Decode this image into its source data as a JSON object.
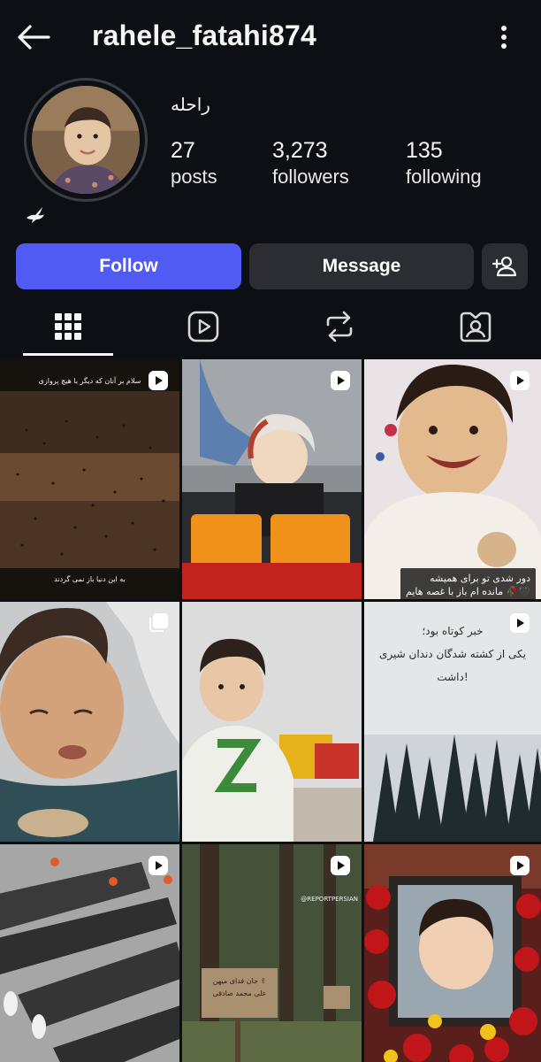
{
  "header": {
    "username": "rahele_fatahi874"
  },
  "profile": {
    "full_name": "راحله",
    "stats": [
      {
        "value": "27",
        "label": "posts"
      },
      {
        "value": "3,273",
        "label": "followers"
      },
      {
        "value": "135",
        "label": "following"
      }
    ]
  },
  "actions": {
    "follow": "Follow",
    "message": "Message"
  },
  "tabs": [
    "grid-icon",
    "reels-icon",
    "reposts-icon",
    "tagged-icon"
  ],
  "posts": [
    {
      "type": "reel",
      "caption_top": "سلام بر آنان که دیگر با هیچ پروازی",
      "caption_bottom": "به این دنیا باز نمی گردند"
    },
    {
      "type": "reel"
    },
    {
      "type": "reel",
      "caption": "دور شدی تو برای همیشه\nمانده ام باز با غصه هایم 🥀🖤"
    },
    {
      "type": "carousel"
    },
    {
      "type": "none"
    },
    {
      "type": "reel",
      "caption": "خبر کوتاه بود؛\nیکی از کشته شدگان دندان شیری داشت!"
    },
    {
      "type": "reel"
    },
    {
      "type": "reel",
      "watermark": "@REPORTPERSIAN",
      "sign_text": "جان فدای میهن ✌\nعلی محمد صادقی"
    },
    {
      "type": "reel"
    }
  ],
  "colors": {
    "follow_button": "#4f5bf2",
    "secondary_button": "#2b2d33",
    "background": "#0c0f14"
  }
}
